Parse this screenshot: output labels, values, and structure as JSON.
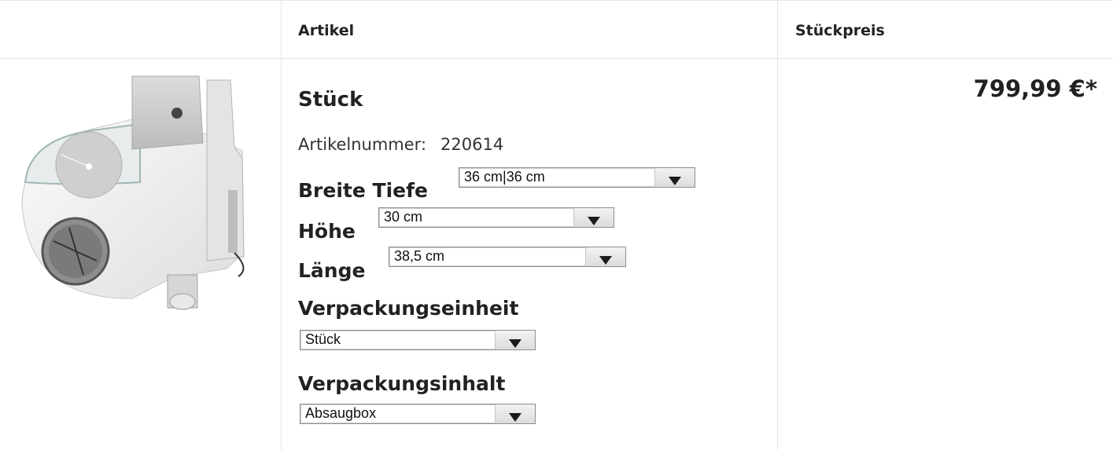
{
  "header": {
    "col_article": "Artikel",
    "col_price": "Stückpreis"
  },
  "product": {
    "title": "Stück",
    "sku_label": "Artikelnummer:",
    "sku_value": "220614",
    "price": "799,99 €*",
    "image_alt": "Absaugbox"
  },
  "attributes": {
    "breite_tiefe": {
      "label": "Breite Tiefe",
      "value": "36 cm|36 cm"
    },
    "hoehe": {
      "label": "Höhe",
      "value": "30 cm"
    },
    "laenge": {
      "label": "Länge",
      "value": "38,5 cm"
    },
    "verpackungseinheit": {
      "label": "Verpackungseinheit",
      "value": "Stück"
    },
    "verpackungsinhalt": {
      "label": "Verpackungsinhalt",
      "value": "Absaugbox"
    }
  }
}
